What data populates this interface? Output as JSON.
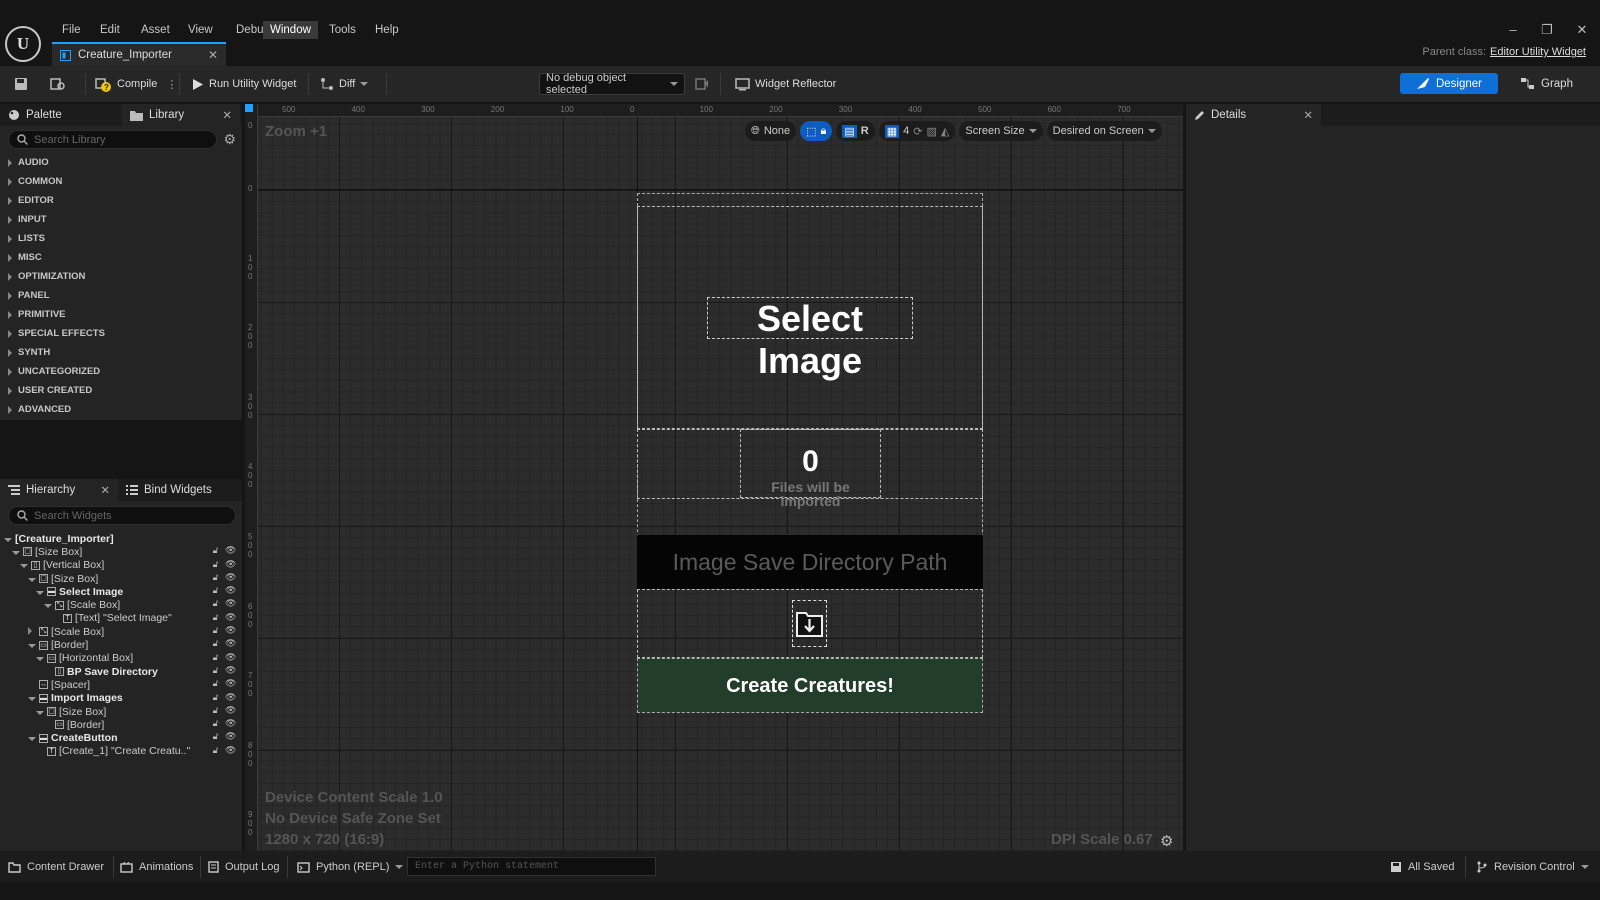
{
  "menu": [
    "File",
    "Edit",
    "Asset",
    "View",
    "Debug",
    "Window",
    "Tools",
    "Help"
  ],
  "active_menu": "Window",
  "tab": {
    "title": "Creature_Importer"
  },
  "parent_class": {
    "label": "Parent class:",
    "value": "Editor Utility Widget"
  },
  "toolbar": {
    "compile": "Compile",
    "run": "Run Utility Widget",
    "diff": "Diff",
    "debug_object": "No debug object selected",
    "widget_reflector": "Widget Reflector",
    "designer": "Designer",
    "graph": "Graph"
  },
  "palette": {
    "tab": "Palette",
    "library_tab": "Library",
    "search_placeholder": "Search Library",
    "categories": [
      "AUDIO",
      "COMMON",
      "EDITOR",
      "INPUT",
      "LISTS",
      "MISC",
      "OPTIMIZATION",
      "PANEL",
      "PRIMITIVE",
      "SPECIAL EFFECTS",
      "SYNTH",
      "UNCATEGORIZED",
      "USER CREATED",
      "ADVANCED"
    ]
  },
  "hierarchy": {
    "tab": "Hierarchy",
    "bind_tab": "Bind Widgets",
    "search_placeholder": "Search Widgets",
    "items": [
      {
        "label": "[Creature_Importer]",
        "bold": true
      },
      {
        "label": "[Size Box]"
      },
      {
        "label": "[Vertical Box]"
      },
      {
        "label": "[Size Box]"
      },
      {
        "label": "Select Image",
        "bold": true
      },
      {
        "label": "[Scale Box]"
      },
      {
        "label": "[Text] \"Select Image\""
      },
      {
        "label": "[Scale Box]"
      },
      {
        "label": "[Border]"
      },
      {
        "label": "[Horizontal Box]"
      },
      {
        "label": "BP Save Directory",
        "bold": true
      },
      {
        "label": "[Spacer]"
      },
      {
        "label": "Import Images",
        "bold": true
      },
      {
        "label": "[Size Box]"
      },
      {
        "label": "[Border]"
      },
      {
        "label": "CreateButton",
        "bold": true
      },
      {
        "label": "[Create_1] \"Create Creatu..\""
      }
    ]
  },
  "canvas": {
    "zoom": "Zoom +1",
    "tools": {
      "none": "None",
      "r": "R",
      "grid_value": "4",
      "screen_size": "Screen Size",
      "desired": "Desired on Screen"
    },
    "top_ruler": [
      "500",
      "400",
      "300",
      "200",
      "100",
      "0",
      "100",
      "200",
      "300",
      "400",
      "500",
      "600",
      "700"
    ],
    "left_ruler": [
      "0",
      "0",
      "1\n0\n0",
      "2\n0\n0",
      "3\n0\n0",
      "4\n0\n0",
      "5\n0\n0",
      "6\n0\n0",
      "7\n0\n0",
      "8\n0\n0",
      "9\n0\n0"
    ],
    "device_content_scale": "Device Content Scale 1.0",
    "safe_zone": "No Device Safe Zone Set",
    "resolution": "1280 x 720 (16:9)",
    "dpi_scale": "DPI Scale 0.67"
  },
  "widget": {
    "select_image": "Select Image",
    "count": "0",
    "count_label": "Files will be imported",
    "path_placeholder": "Image Save Directory Path",
    "create_button": "Create Creatures!"
  },
  "details": {
    "tab": "Details"
  },
  "statusbar": {
    "content_drawer": "Content Drawer",
    "animations": "Animations",
    "output_log": "Output Log",
    "python": "Python (REPL)",
    "python_placeholder": "Enter a Python statement",
    "all_saved": "All Saved",
    "revision_control": "Revision Control"
  },
  "colors": {
    "accent": "#0e6fd6",
    "tab_highlight": "#1ea2ff",
    "create_button_bg": "#223d2a",
    "play_green": "#3fae3f"
  }
}
